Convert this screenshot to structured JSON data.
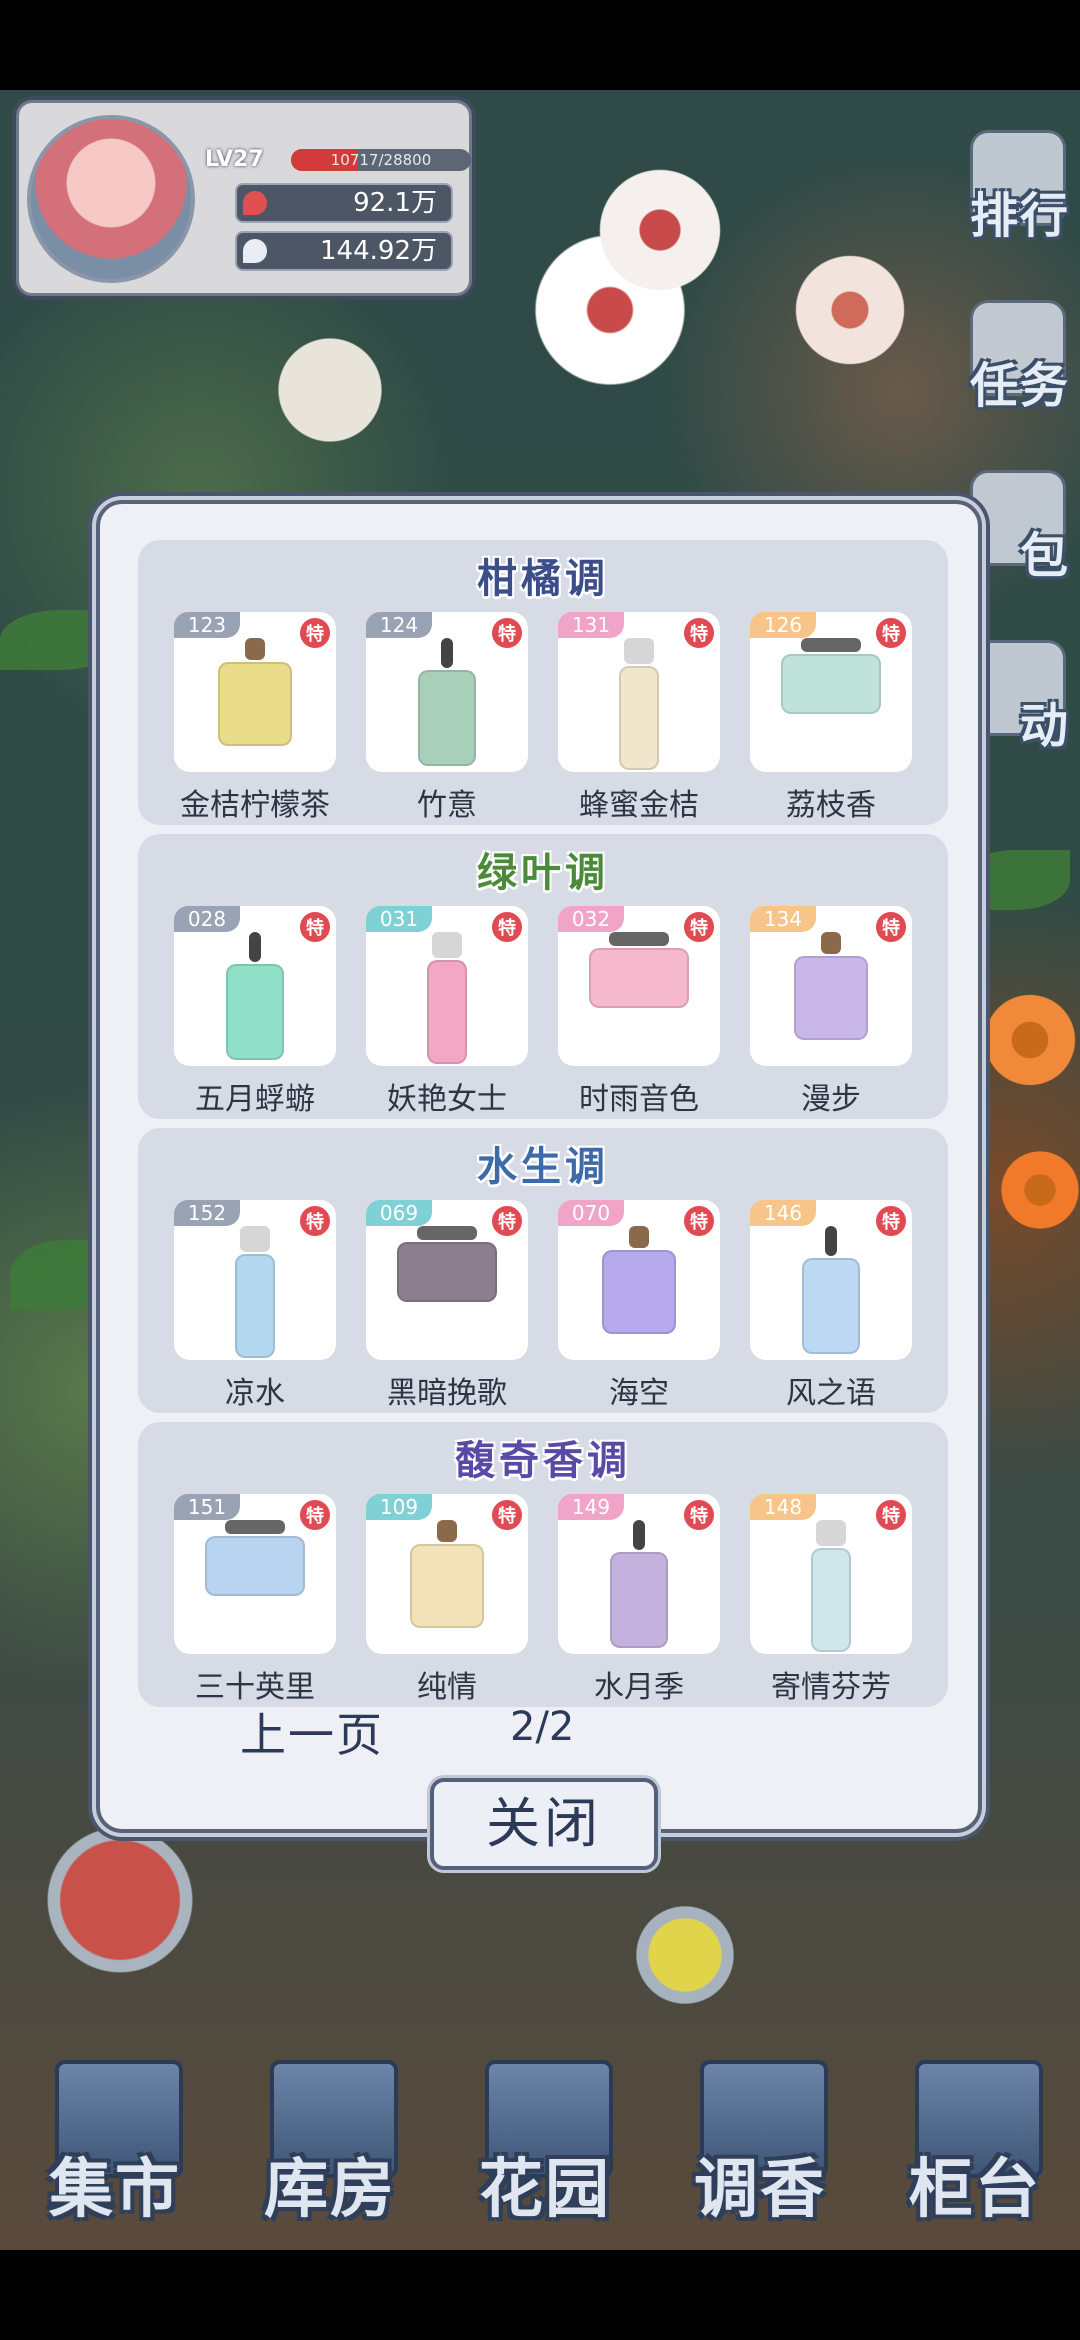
{
  "player": {
    "level": "LV27",
    "exp": "10717/28800",
    "exp_fraction": 0.37,
    "coins": "92.1万",
    "gems": "144.92万"
  },
  "side_menu": [
    "排行",
    "任务",
    "包",
    "动"
  ],
  "sections": [
    {
      "title": "柑橘调",
      "title_color": "#3b4e8a",
      "items": [
        {
          "num": "123",
          "name": "金桔柠檬茶",
          "badge": "特",
          "tag_color": "#9aa3b3",
          "bottle_color": "#e9dc8a"
        },
        {
          "num": "124",
          "name": "竹意",
          "badge": "特",
          "tag_color": "#9aa3b3",
          "bottle_color": "#a8cfb9"
        },
        {
          "num": "131",
          "name": "蜂蜜金桔",
          "badge": "特",
          "tag_color": "#f0a4c8",
          "bottle_color": "#efe6cc"
        },
        {
          "num": "126",
          "name": "荔枝香",
          "badge": "特",
          "tag_color": "#f7c58a",
          "bottle_color": "#bfe3da"
        }
      ]
    },
    {
      "title": "绿叶调",
      "title_color": "#4a8a3a",
      "items": [
        {
          "num": "028",
          "name": "五月蜉蝣",
          "badge": "特",
          "tag_color": "#9aa3b3",
          "bottle_color": "#8fe0c6"
        },
        {
          "num": "031",
          "name": "妖艳女士",
          "badge": "特",
          "tag_color": "#7fd1d6",
          "bottle_color": "#f2a7c4"
        },
        {
          "num": "032",
          "name": "时雨音色",
          "badge": "特",
          "tag_color": "#f0a4c8",
          "bottle_color": "#f5b8cc"
        },
        {
          "num": "134",
          "name": "漫步",
          "badge": "特",
          "tag_color": "#f7c58a",
          "bottle_color": "#c9b7ea"
        }
      ]
    },
    {
      "title": "水生调",
      "title_color": "#3d6aa8",
      "items": [
        {
          "num": "152",
          "name": "凉水",
          "badge": "特",
          "tag_color": "#9aa3b3",
          "bottle_color": "#b4d7f0"
        },
        {
          "num": "069",
          "name": "黑暗挽歌",
          "badge": "特",
          "tag_color": "#7fd1d6",
          "bottle_color": "#8c7e8e"
        },
        {
          "num": "070",
          "name": "海空",
          "badge": "特",
          "tag_color": "#f0a4c8",
          "bottle_color": "#b6a9ec"
        },
        {
          "num": "146",
          "name": "风之语",
          "badge": "特",
          "tag_color": "#f7c58a",
          "bottle_color": "#bcd8f2"
        }
      ]
    },
    {
      "title": "馥奇香调",
      "title_color": "#5a4aa8",
      "items": [
        {
          "num": "151",
          "name": "三十英里",
          "badge": "特",
          "tag_color": "#9aa3b3",
          "bottle_color": "#b9d4f0"
        },
        {
          "num": "109",
          "name": "纯情",
          "badge": "特",
          "tag_color": "#7fd1d6",
          "bottle_color": "#f1e2b8"
        },
        {
          "num": "149",
          "name": "水月季",
          "badge": "特",
          "tag_color": "#f0a4c8",
          "bottle_color": "#c4b2de"
        },
        {
          "num": "148",
          "name": "寄情芬芳",
          "badge": "特",
          "tag_color": "#f7c58a",
          "bottle_color": "#cfe6ea"
        }
      ]
    }
  ],
  "pager": {
    "prev_label": "上一页",
    "page": "2/2"
  },
  "close_label": "关闭",
  "bottom_nav": [
    "集市",
    "库房",
    "花园",
    "调香",
    "柜台"
  ]
}
